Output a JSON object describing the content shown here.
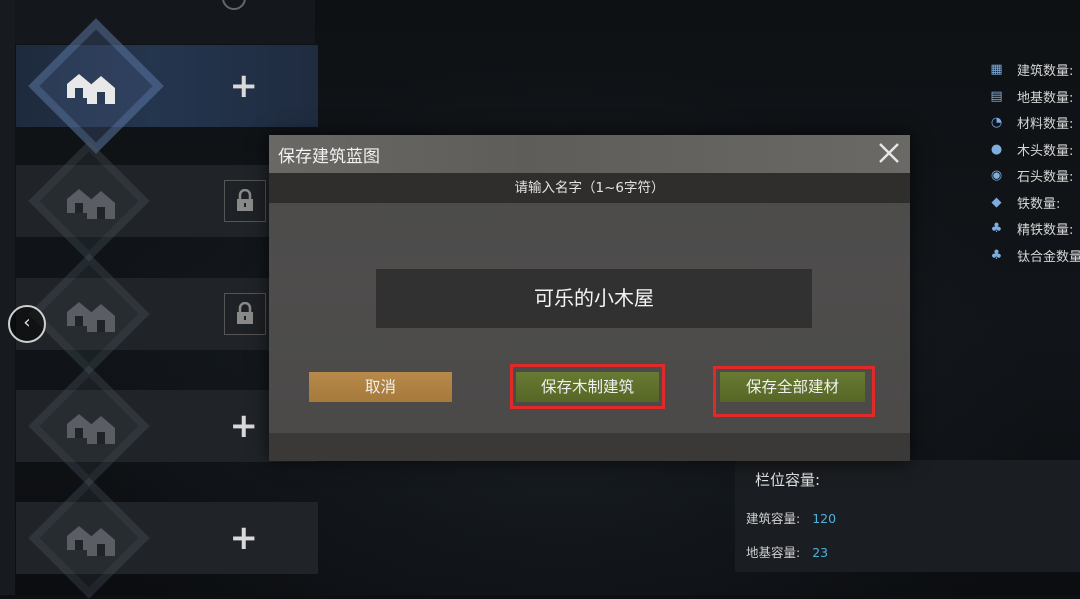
{
  "dialog": {
    "title": "保存建筑蓝图",
    "prompt": "请输入名字（1~6字符）",
    "name_value": "可乐的小木屋",
    "cancel_label": "取消",
    "save_wood_label": "保存木制建筑",
    "save_all_label": "保存全部建材"
  },
  "slots": [
    {
      "state": "add",
      "action_icon": "plus-icon",
      "active": true
    },
    {
      "state": "locked",
      "action_icon": "lock-icon"
    },
    {
      "state": "locked",
      "action_icon": "lock-icon"
    },
    {
      "state": "add",
      "action_icon": "plus-icon"
    },
    {
      "state": "add",
      "action_icon": "plus-icon"
    }
  ],
  "stats": [
    {
      "icon": "building-icon",
      "label": "建筑数量:"
    },
    {
      "icon": "foundation-icon",
      "label": "地基数量:"
    },
    {
      "icon": "material-icon",
      "label": "材料数量:"
    },
    {
      "icon": "wood-icon",
      "label": "木头数量:"
    },
    {
      "icon": "stone-icon",
      "label": "石头数量:"
    },
    {
      "icon": "iron-icon",
      "label": "铁数量:"
    },
    {
      "icon": "refined-iron-icon",
      "label": "精铁数量:"
    },
    {
      "icon": "titanium-icon",
      "label": "钛合金数量:"
    }
  ],
  "capacity": {
    "title": "栏位容量:",
    "building_label": "建筑容量:",
    "building_value": "120",
    "foundation_label": "地基容量:",
    "foundation_value": "23"
  },
  "colors": {
    "highlight": "#e02a2a",
    "confirm_button": "#6a7b35",
    "cancel_button": "#b0854a",
    "capacity_value": "#4fb2d8"
  }
}
